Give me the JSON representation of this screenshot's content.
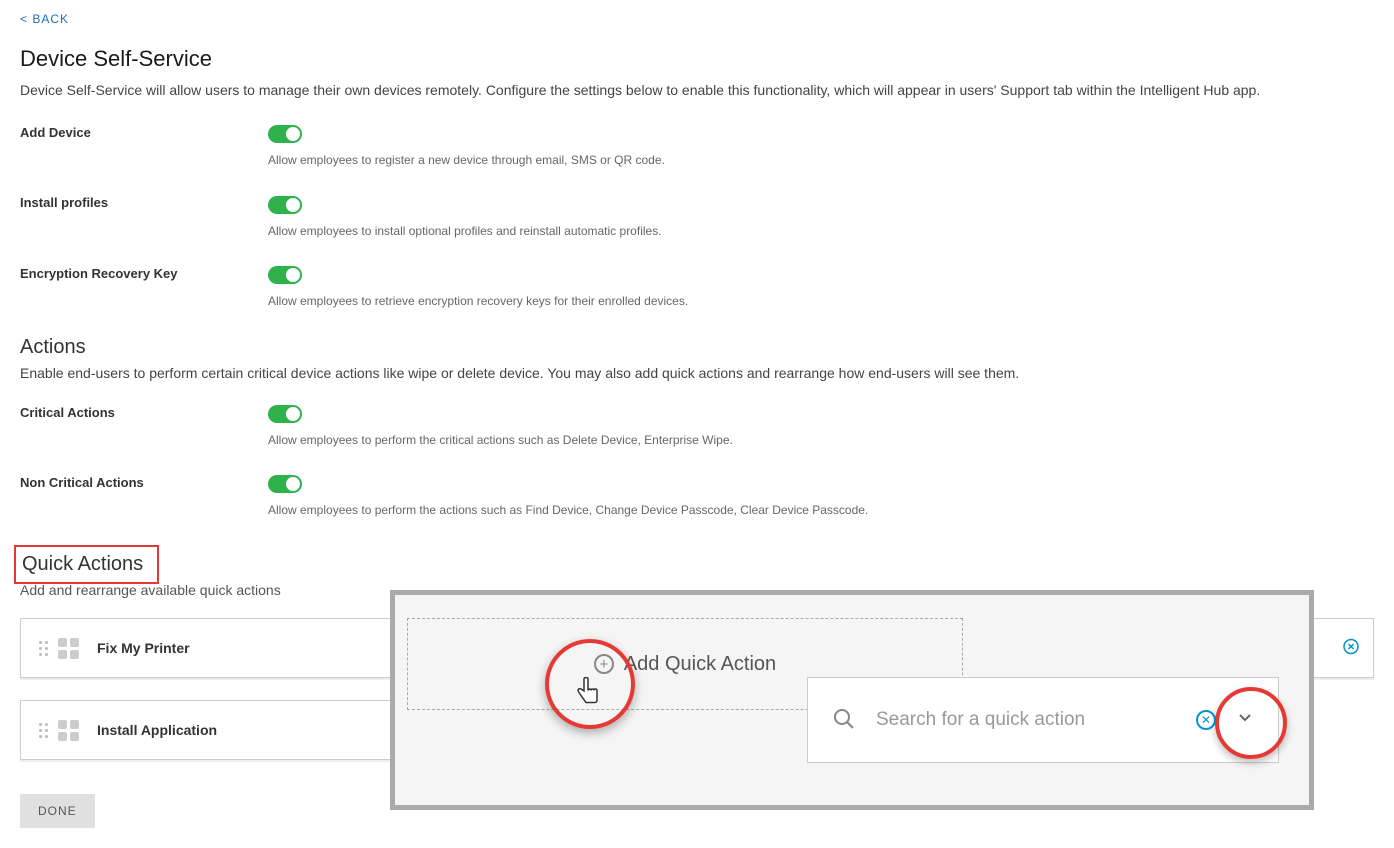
{
  "back": "< BACK",
  "device_self_service": {
    "title": "Device Self-Service",
    "desc": "Device Self-Service will allow users to manage their own devices remotely. Configure the settings below to enable this functionality, which will appear in users' Support tab within the Intelligent Hub app."
  },
  "settings": [
    {
      "label": "Add Device",
      "help": "Allow employees to register a new device through email, SMS or QR code."
    },
    {
      "label": "Install profiles",
      "help": "Allow employees to install optional profiles and reinstall automatic profiles."
    },
    {
      "label": "Encryption Recovery Key",
      "help": "Allow employees to retrieve encryption recovery keys for their enrolled devices."
    }
  ],
  "actions": {
    "title": "Actions",
    "desc": "Enable end-users to perform certain critical device actions like wipe or delete device. You may also add quick actions and rearrange how end-users will see them.",
    "rows": [
      {
        "label": "Critical Actions",
        "help": "Allow employees to perform the critical actions such as Delete Device, Enterprise Wipe."
      },
      {
        "label": "Non Critical Actions",
        "help": "Allow employees to perform the actions such as Find Device, Change Device Passcode, Clear Device Passcode."
      }
    ]
  },
  "quick_actions": {
    "title": "Quick Actions",
    "desc": "Add and rearrange available quick actions",
    "cards": [
      "Fix My Printer",
      "Install Application"
    ],
    "done": "DONE"
  },
  "overlay": {
    "add_label": "Add Quick Action",
    "search_placeholder": "Search for a quick action"
  }
}
